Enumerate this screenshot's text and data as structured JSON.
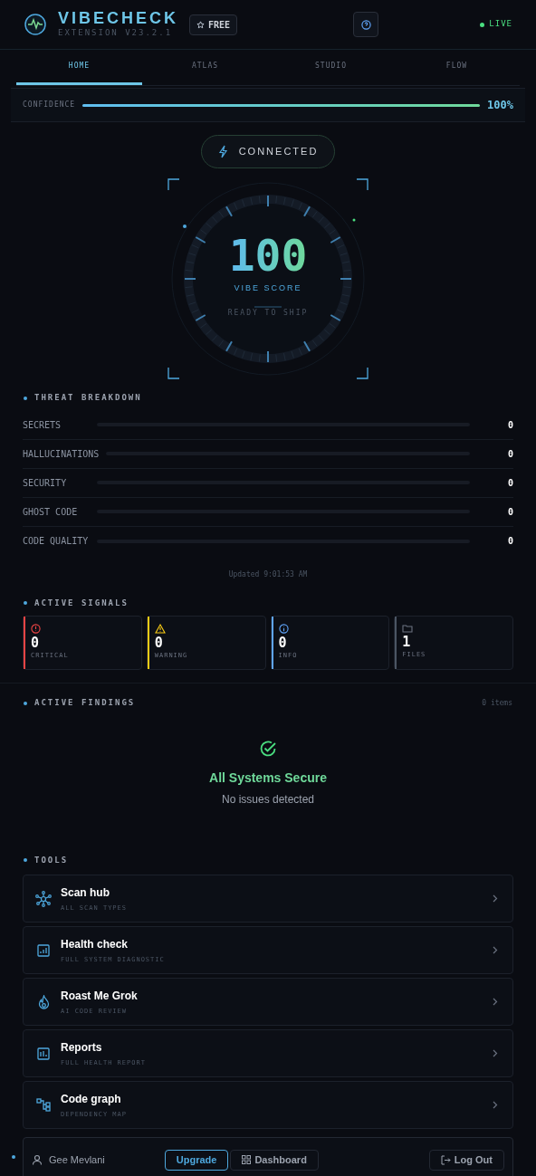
{
  "header": {
    "title": "VIBECHECK",
    "subtitle": "EXTENSION V23.2.1",
    "plan_badge": "FREE",
    "status": "LIVE"
  },
  "tabs": [
    {
      "label": "HOME",
      "selected": true
    },
    {
      "label": "ATLAS",
      "selected": false
    },
    {
      "label": "STUDIO",
      "selected": false
    },
    {
      "label": "FLOW",
      "selected": false
    }
  ],
  "confidence": {
    "label": "CONFIDENCE",
    "level": 1,
    "reading": "100%"
  },
  "connection": {
    "label": "CONNECTED"
  },
  "score": {
    "value": "100",
    "label": "VIBE SCORE",
    "caption": "READY TO SHIP"
  },
  "threat_breakdown": {
    "title": "THREAT BREAKDOWN",
    "rows": [
      {
        "label": "SECRETS",
        "level": 0,
        "count": "0"
      },
      {
        "label": "HALLUCINATIONS",
        "level": 0,
        "count": "0"
      },
      {
        "label": "SECURITY",
        "level": 0,
        "count": "0"
      },
      {
        "label": "GHOST CODE",
        "level": 0,
        "count": "0"
      },
      {
        "label": "CODE QUALITY",
        "level": 0,
        "count": "0"
      }
    ],
    "updated": "Updated 9:01:53 AM"
  },
  "active_signals": {
    "title": "ACTIVE SIGNALS",
    "cards": [
      {
        "kind": "critical",
        "value": "0",
        "label": "CRITICAL",
        "color": "#ef4444"
      },
      {
        "kind": "warning",
        "value": "0",
        "label": "WARNING",
        "color": "#facc15"
      },
      {
        "kind": "info",
        "value": "0",
        "label": "INFO",
        "color": "#60a5fa"
      },
      {
        "kind": "files",
        "value": "1",
        "label": "FILES",
        "color": "#4b5563"
      }
    ]
  },
  "active_findings": {
    "title": "ACTIVE FINDINGS",
    "count": "0 items",
    "empty_title": "All Systems Secure",
    "empty_text": "No issues detected"
  },
  "tools": {
    "title": "TOOLS",
    "items": [
      {
        "kind": "hub",
        "title": "Scan hub",
        "subtitle": "ALL SCAN TYPES"
      },
      {
        "kind": "health",
        "title": "Health check",
        "subtitle": "FULL SYSTEM DIAGNOSTIC"
      },
      {
        "kind": "roast",
        "title": "Roast Me Grok",
        "subtitle": "AI CODE REVIEW"
      },
      {
        "kind": "reports",
        "title": "Reports",
        "subtitle": "FULL HEALTH REPORT"
      },
      {
        "kind": "graph",
        "title": "Code graph",
        "subtitle": "DEPENDENCY MAP"
      }
    ]
  },
  "footer": {
    "user": "Gee Mevlani",
    "upgrade": "Upgrade",
    "dashboard": "Dashboard",
    "logout": "Log Out"
  }
}
